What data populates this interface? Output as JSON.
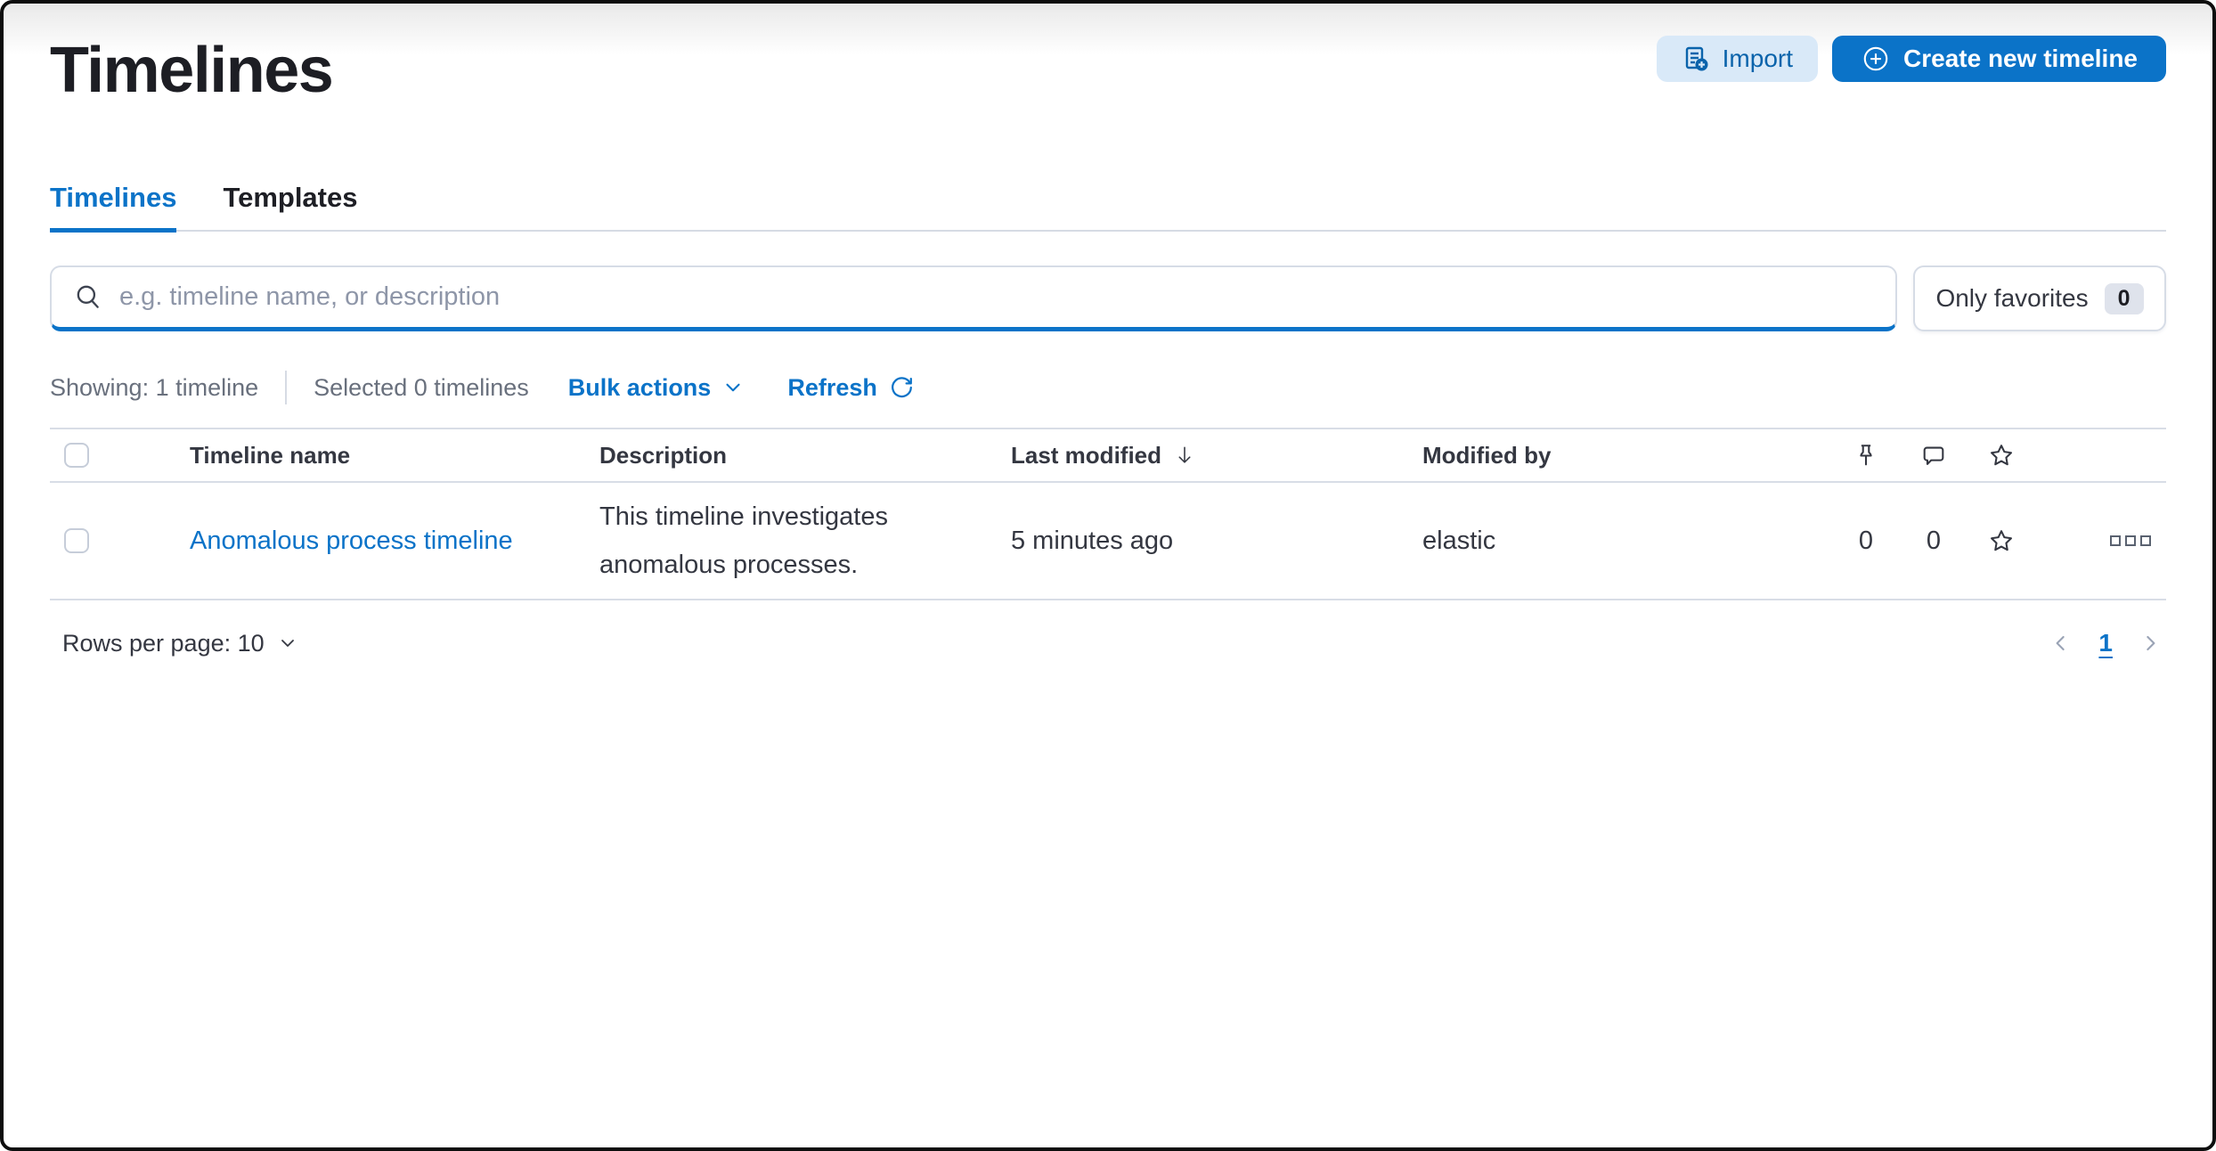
{
  "page": {
    "title": "Timelines"
  },
  "header": {
    "import_label": "Import",
    "create_label": "Create new timeline"
  },
  "tabs": [
    {
      "label": "Timelines",
      "active": true
    },
    {
      "label": "Templates",
      "active": false
    }
  ],
  "search": {
    "placeholder": "e.g. timeline name, or description",
    "only_favorites_label": "Only favorites",
    "favorites_count": "0"
  },
  "meta": {
    "showing": "Showing: 1 timeline",
    "selected": "Selected 0 timelines",
    "bulk_actions_label": "Bulk actions",
    "refresh_label": "Refresh"
  },
  "table": {
    "headers": {
      "name": "Timeline name",
      "description": "Description",
      "last_modified": "Last modified",
      "modified_by": "Modified by"
    },
    "rows": [
      {
        "name": "Anomalous process timeline",
        "description": "This timeline investigates anomalous processes.",
        "last_modified": "5 minutes ago",
        "modified_by": "elastic",
        "pinned_count": "0",
        "comment_count": "0"
      }
    ]
  },
  "footer": {
    "rows_per_page_label": "Rows per page: 10",
    "page_number": "1"
  },
  "icons": {
    "search": "search-icon",
    "import": "import-icon",
    "create": "plus-in-circle-icon",
    "chevron_down": "chevron-down-icon",
    "refresh": "refresh-icon",
    "sort_down": "sort-down-icon",
    "pin": "pin-icon",
    "comment": "comment-icon",
    "star": "star-icon",
    "actions": "boxes-horizontal-icon",
    "prev": "chevron-left-icon",
    "next": "chevron-right-icon"
  },
  "colors": {
    "primary_blue": "#0b73c8",
    "import_button_bg": "#d9e9f8",
    "import_button_text": "#0a63ab",
    "text_dark": "#1d1e24",
    "text_body": "#343741",
    "text_subdued": "#69707d",
    "border_gray": "#d6dbe4",
    "badge_bg": "#dfe3ec",
    "disabled_arrow": "#9aa3b5"
  }
}
